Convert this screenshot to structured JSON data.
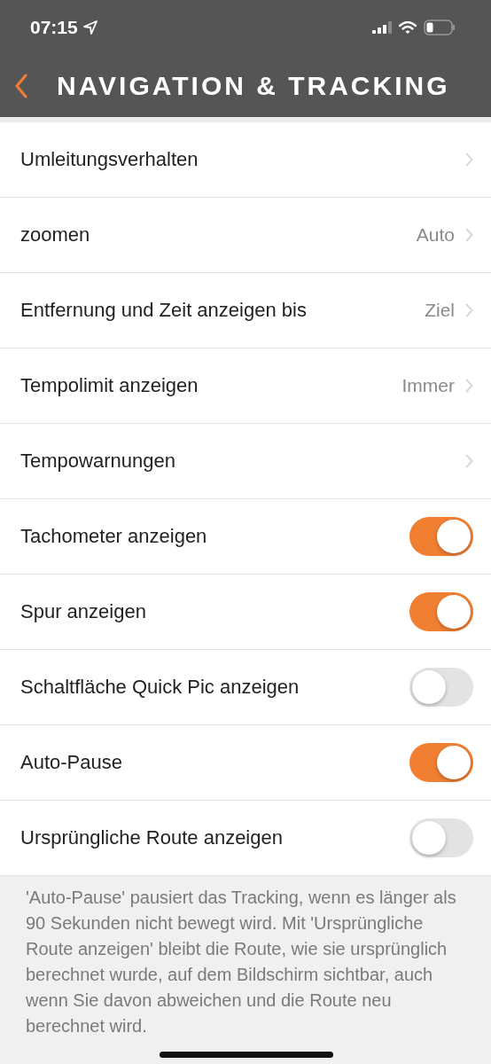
{
  "status_bar": {
    "time": "07:15"
  },
  "header": {
    "title": "NAVIGATION & TRACKING"
  },
  "rows": [
    {
      "kind": "link",
      "label": "Umleitungsverhalten"
    },
    {
      "kind": "link",
      "label": "zoomen",
      "value": "Auto"
    },
    {
      "kind": "link",
      "label": "Entfernung und Zeit anzeigen bis",
      "value": "Ziel"
    },
    {
      "kind": "link",
      "label": "Tempolimit anzeigen",
      "value": "Immer"
    },
    {
      "kind": "link",
      "label": "Tempowarnungen"
    },
    {
      "kind": "toggle",
      "label": "Tachometer anzeigen",
      "on": true
    },
    {
      "kind": "toggle",
      "label": "Spur anzeigen",
      "on": true
    },
    {
      "kind": "toggle",
      "label": "Schaltfläche Quick Pic anzeigen",
      "on": false
    },
    {
      "kind": "toggle",
      "label": "Auto-Pause",
      "on": true
    },
    {
      "kind": "toggle",
      "label": "Ursprüngliche Route anzeigen",
      "on": false
    }
  ],
  "note": "'Auto-Pause' pausiert das Tracking, wenn es länger als 90 Sekunden nicht bewegt wird. Mit 'Ursprüngliche Route anzeigen' bleibt die Route, wie sie ursprünglich berechnet wurde, auf dem Bildschirm sichtbar, auch wenn Sie davon abweichen und die Route neu berechnet wird."
}
